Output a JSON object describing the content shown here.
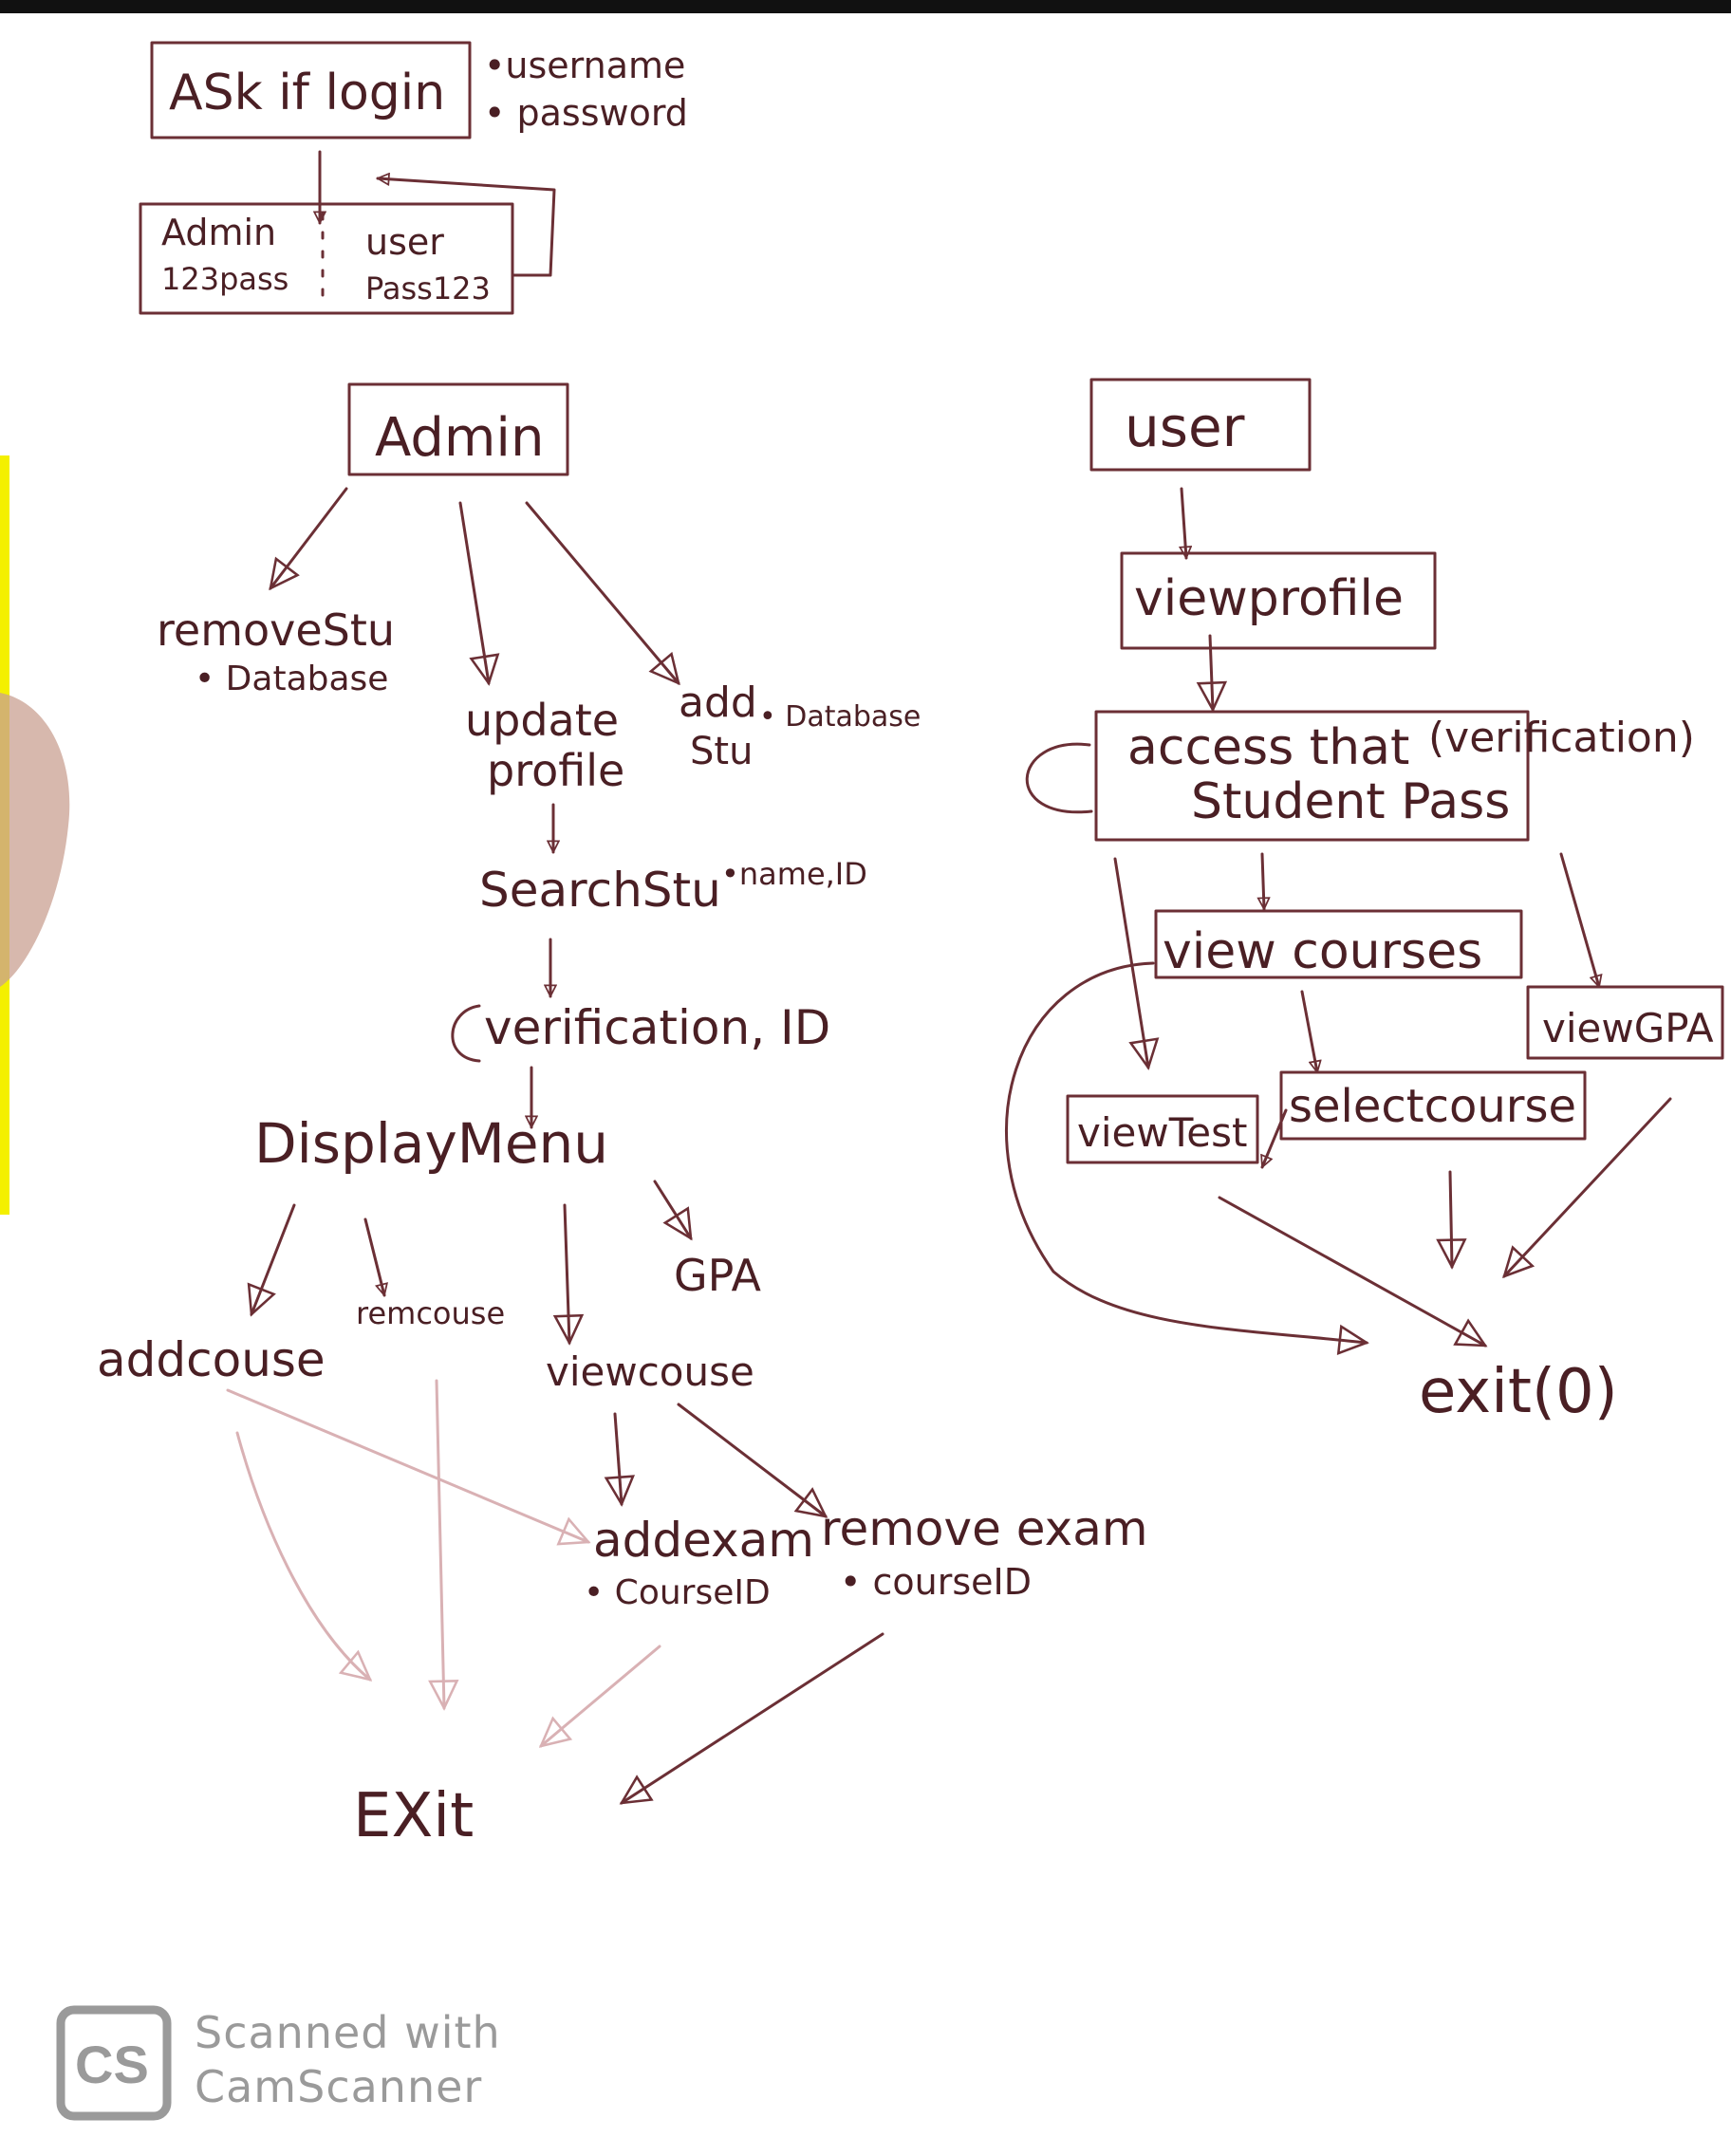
{
  "page": {
    "background": "#ffffff",
    "ink_color": "#6b2f35",
    "edge_color": "#f4f000"
  },
  "diagram": {
    "login": {
      "title": "ASk if login",
      "inputs": [
        "•username",
        "• password"
      ],
      "admin_cred_name": "Admin",
      "admin_cred_pass": "123pass",
      "user_cred_name": "user",
      "user_cred_pass": "Pass123"
    },
    "admin_branch": {
      "title": "Admin",
      "remove_stu": "removeStu",
      "remove_stu_note": "• Database",
      "update_profile": [
        "update",
        "profile"
      ],
      "add_stu": [
        "add",
        "Stu"
      ],
      "add_stu_note": "• Database",
      "search_stu": "SearchStu",
      "search_stu_note": "•name,ID",
      "verification": "verification, ID",
      "display_menu": "DisplayMenu",
      "add_course": "addcouse",
      "rem_course": "remcouse",
      "view_course": "viewcouse",
      "gpa": "GPA",
      "add_exam": "addexam",
      "add_exam_note": "• CourseID",
      "remove_exam": "remove exam",
      "remove_exam_note": "• courseID",
      "exit": "EXit"
    },
    "user_branch": {
      "title": "user",
      "view_profile": "viewprofile",
      "access_line1": "access that",
      "access_line2": "Student Pass",
      "access_note": "(verification)",
      "view_courses": "view courses",
      "view_gpa": "viewGPA",
      "view_test": "viewTest",
      "select_course": "selectcourse",
      "exit": "exit(0)"
    }
  },
  "watermark": {
    "logo": "CS",
    "line1": "Scanned with",
    "line2": "CamScanner"
  }
}
